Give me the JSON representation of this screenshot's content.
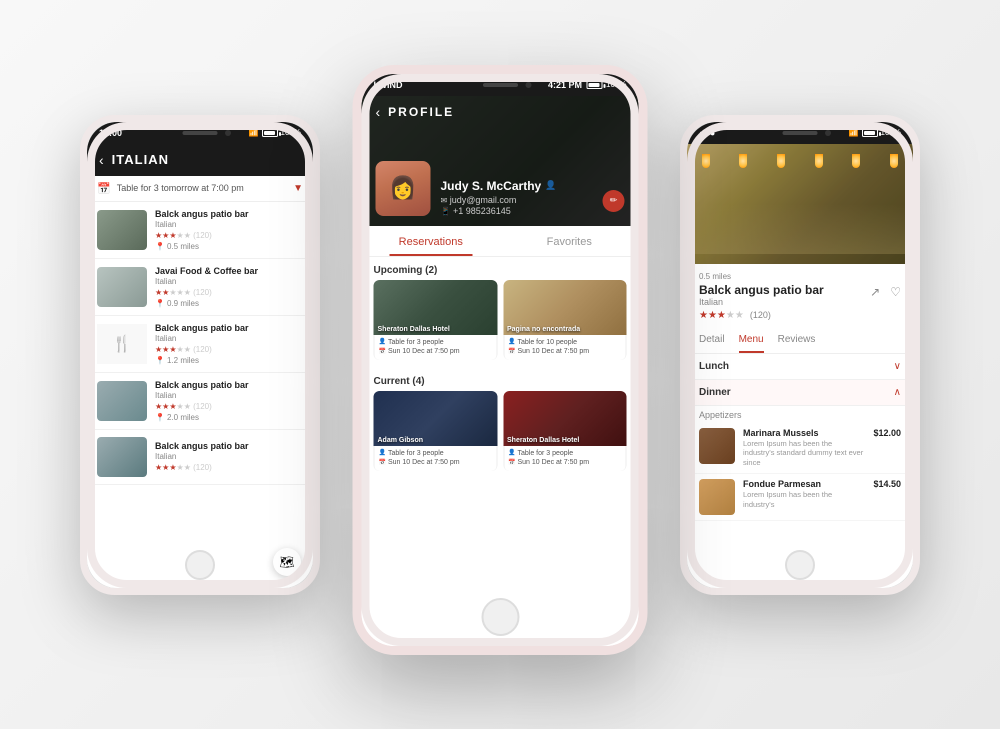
{
  "app": {
    "background_color": "#e8e8e8"
  },
  "left_phone": {
    "status_bar": {
      "time": "12:00",
      "wifi": true,
      "battery": "100%"
    },
    "header": {
      "back_label": "‹",
      "title": "ITALIAN"
    },
    "filter_bar": {
      "text": "Table for 3 tomorrow at 7:00 pm",
      "icon": "📅"
    },
    "restaurants": [
      {
        "name": "Balck angus patio bar",
        "cuisine": "Italian",
        "rating": 3,
        "max_rating": 5,
        "review_count": "(120)",
        "distance": "0.5 miles",
        "has_image": true
      },
      {
        "name": "Javai Food & Coffee bar",
        "cuisine": "Italian",
        "rating": 2,
        "max_rating": 5,
        "review_count": "(120)",
        "distance": "0.9 miles",
        "has_image": true
      },
      {
        "name": "Balck angus patio bar",
        "cuisine": "Italian",
        "rating": 3,
        "max_rating": 5,
        "review_count": "(120)",
        "distance": "1.2 miles",
        "has_image": false
      },
      {
        "name": "Balck angus patio bar",
        "cuisine": "Italian",
        "rating": 3,
        "max_rating": 5,
        "review_count": "(120)",
        "distance": "2.0 miles",
        "has_image": true
      },
      {
        "name": "Balck angus patio bar",
        "cuisine": "Italian",
        "rating": 3,
        "max_rating": 5,
        "review_count": "(120)",
        "distance": "",
        "has_image": true
      }
    ]
  },
  "center_phone": {
    "status_bar": {
      "carrier": "I WIND",
      "time": "4:21 PM",
      "battery": "100%"
    },
    "header": {
      "back_label": "‹",
      "title": "PROFILE"
    },
    "profile": {
      "name": "Judy S. McCarthy",
      "email": "judy@gmail.com",
      "phone": "+1 985236145",
      "edit_icon": "✏"
    },
    "tabs": [
      {
        "label": "Reservations",
        "active": true
      },
      {
        "label": "Favorites",
        "active": false
      }
    ],
    "upcoming_label": "Upcoming (2)",
    "current_label": "Current (4)",
    "upcoming_reservations": [
      {
        "name": "Sheraton Dallas Hotel",
        "table": "Table for 3 people",
        "date": "Sun 10 Dec at 7:50 pm"
      },
      {
        "name": "Pagina no encontrada",
        "table": "Table for 10 people",
        "date": "Sun 10 Dec at 7:50 pm"
      }
    ],
    "current_reservations": [
      {
        "name": "Adam Gibson",
        "table": "Table for 3 people",
        "date": "Sun 10 Dec at 7:50 pm"
      },
      {
        "name": "Sheraton Dallas Hotel",
        "table": "Table for 3 people",
        "date": "Sun 10 Dec at 7:50 pm"
      }
    ]
  },
  "right_phone": {
    "status_bar": {
      "time": "...",
      "battery": "100%"
    },
    "restaurant": {
      "distance": "0.5 miles",
      "name": "Balck angus patio bar",
      "cuisine": "Italian",
      "rating": 3,
      "max_rating": 5,
      "review_count": "(120)"
    },
    "tabs": [
      {
        "label": "Detail",
        "active": false
      },
      {
        "label": "Menu",
        "active": true
      },
      {
        "label": "Reviews",
        "active": false
      }
    ],
    "menu_sections": [
      {
        "name": "Lunch",
        "expanded": false
      },
      {
        "name": "Dinner",
        "expanded": true
      }
    ],
    "category": "Appetizers",
    "menu_items": [
      {
        "name": "Marinara Mussels",
        "description": "Lorem Ipsum has been the industry's standard dummy text ever since",
        "price": "$12.00"
      },
      {
        "name": "Fondue Parmesan",
        "description": "Lorem Ipsum has been the industry's",
        "price": "$14.50"
      }
    ]
  }
}
